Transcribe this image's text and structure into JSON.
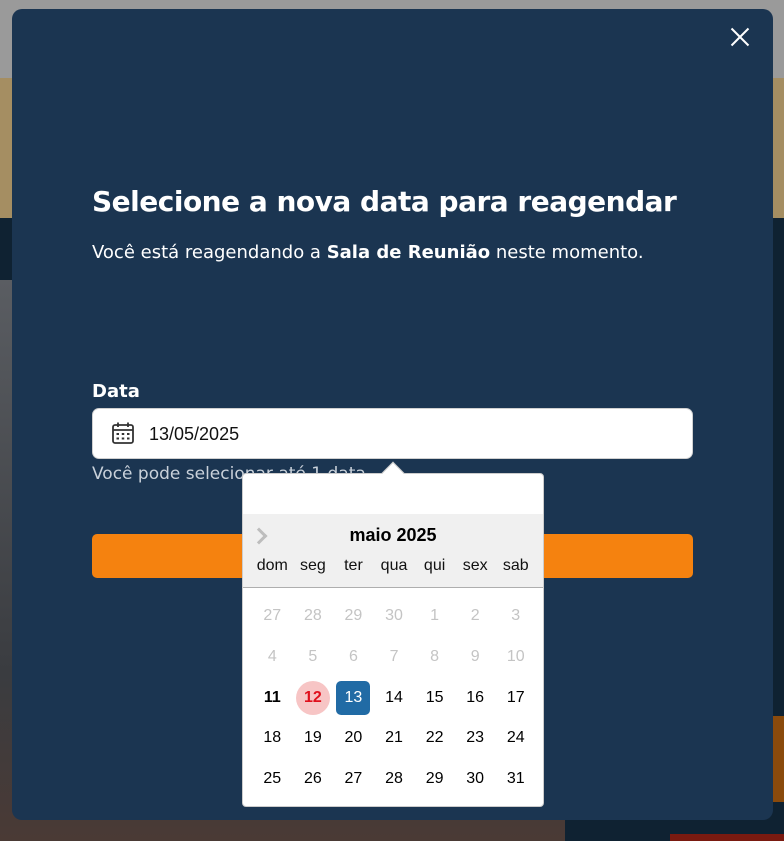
{
  "modal": {
    "title": "Selecione a nova data para reagendar",
    "subtitle_prefix": "Você está reagendando a ",
    "subtitle_room": "Sala de Reunião",
    "subtitle_suffix": " neste momento.",
    "date_label": "Data",
    "date_value": "13/05/2025",
    "hint": "Você pode selecionar até 1 data"
  },
  "calendar": {
    "month_title": "maio 2025",
    "weekdays": [
      "dom",
      "seg",
      "ter",
      "qua",
      "qui",
      "sex",
      "sab"
    ],
    "weeks": [
      [
        "27",
        "28",
        "29",
        "30",
        "1",
        "2",
        "3"
      ],
      [
        "4",
        "5",
        "6",
        "7",
        "8",
        "9",
        "10"
      ],
      [
        "11",
        "12",
        "13",
        "14",
        "15",
        "16",
        "17"
      ],
      [
        "18",
        "19",
        "20",
        "21",
        "22",
        "23",
        "24"
      ],
      [
        "25",
        "26",
        "27",
        "28",
        "29",
        "30",
        "31"
      ]
    ],
    "today": "12",
    "selected": "13"
  },
  "colors": {
    "modal_bg": "#1b3551",
    "accent_orange": "#f5820f",
    "selected_day": "#216ba5",
    "today_text": "#e0101c",
    "today_bg": "#f7c5c5"
  },
  "icons": {
    "close": "close-icon",
    "calendar": "calendar-icon",
    "next_month": "chevron-right-icon"
  }
}
